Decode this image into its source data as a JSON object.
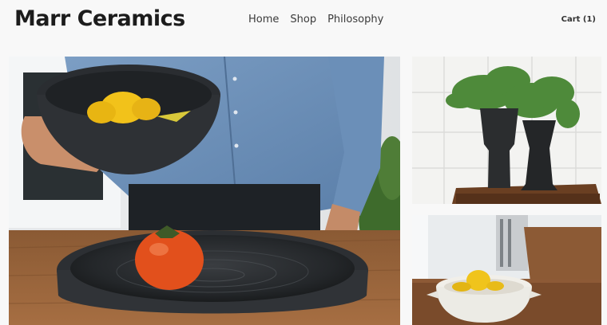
{
  "header": {
    "brand": "Marr Ceramics",
    "nav": [
      {
        "label": "Home"
      },
      {
        "label": "Shop"
      },
      {
        "label": "Philosophy"
      }
    ],
    "cart_label": "Cart (1)"
  },
  "gallery": [
    {
      "subject": "person holding dark bowl of lemons above large dark platter with persimmon"
    },
    {
      "subject": "two dark vases with ferns"
    },
    {
      "subject": "white lidded bowl with lemons"
    }
  ]
}
